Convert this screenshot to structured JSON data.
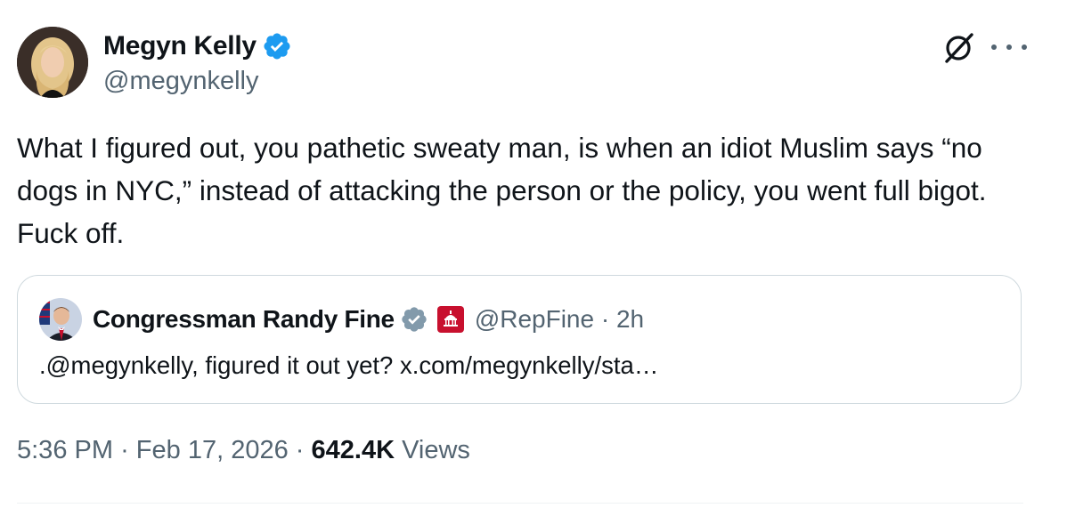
{
  "author": {
    "name": "Megyn Kelly",
    "handle": "@megynkelly",
    "verified_color": "#1d9bf0"
  },
  "tweet": {
    "text": "What I figured out, you pathetic sweaty man, is when an idiot Muslim says “no dogs in NYC,” instead of attacking the person or the policy, you went full bigot. Fuck off."
  },
  "quote": {
    "name": "Congressman Randy Fine",
    "handle": "@RepFine",
    "separator": "·",
    "time": "2h",
    "text": ".@megynkelly, figured it out yet? x.com/megynkelly/sta…",
    "verified_color": "#829aab",
    "affiliation_color": "#c8102e"
  },
  "meta": {
    "time": "5:36 PM",
    "separator": "·",
    "date": "Feb 17, 2026",
    "views_count": "642.4K",
    "views_label": "Views"
  },
  "icons": {
    "grok": "grok-icon",
    "more": "more-icon",
    "verified": "verified-badge-icon",
    "affiliation": "us-capitol-icon"
  }
}
